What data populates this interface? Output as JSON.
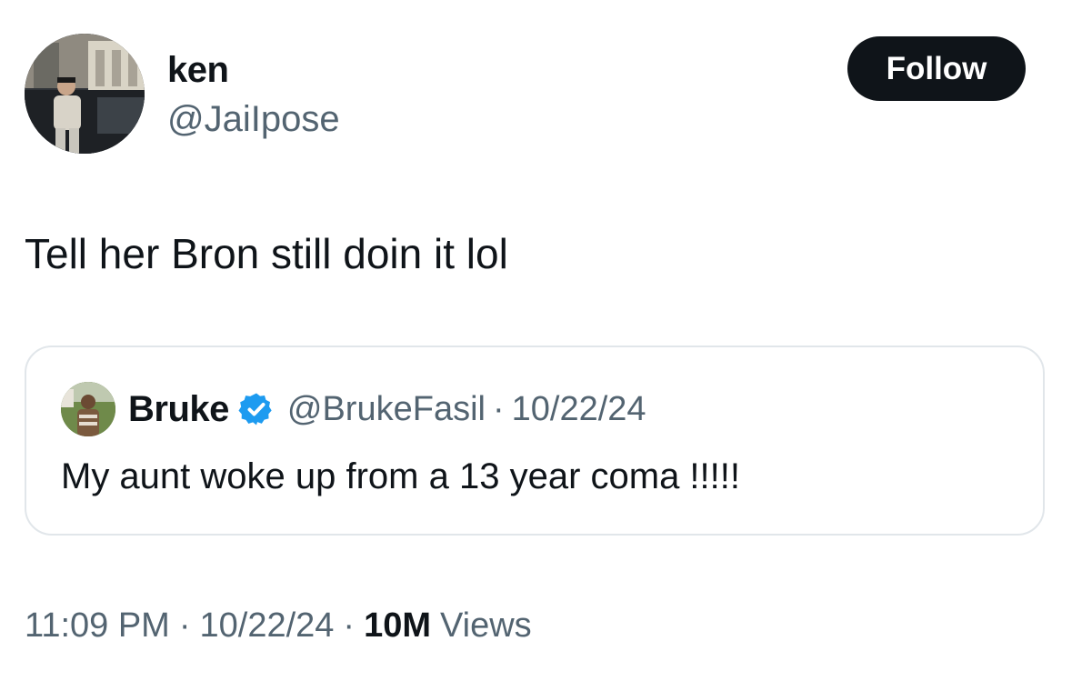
{
  "author": {
    "display_name": "ken",
    "handle": "@JaiIpose",
    "avatar_icon": "profile-photo"
  },
  "follow_button": {
    "label": "Follow",
    "background": "#0f1419",
    "color": "#ffffff"
  },
  "tweet": {
    "text": "Tell her Bron still doin it lol"
  },
  "quoted_tweet": {
    "display_name": "Bruke",
    "verified": true,
    "verified_icon": "verified-badge-icon",
    "verified_color": "#1d9bf0",
    "handle": "@BrukeFasil",
    "separator": "·",
    "date": "10/22/24",
    "text": "My aunt woke up from a 13 year coma !!!!!"
  },
  "meta": {
    "time": "11:09 PM",
    "separator": "·",
    "date": "10/22/24",
    "views_count": "10M",
    "views_label": "Views"
  },
  "colors": {
    "text_primary": "#0f1419",
    "text_secondary": "#536471",
    "border": "#e1e6ea"
  }
}
